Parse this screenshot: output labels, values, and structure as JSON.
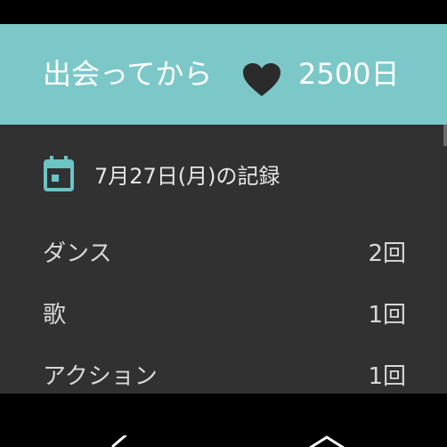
{
  "header": {
    "title": "出会ってから",
    "days": "2500日",
    "icon": "heart-icon",
    "background_color": "#7cc8c8"
  },
  "record": {
    "icon": "calendar-icon",
    "date_label": "7月27日(月)の記録",
    "accent_color": "#6cc4c4",
    "items": [
      {
        "label": "ダンス",
        "count": "2回"
      },
      {
        "label": "歌",
        "count": "1回"
      },
      {
        "label": "アクション",
        "count": "1回"
      }
    ]
  },
  "nav": {
    "back_icon": "back-icon",
    "home_icon": "home-icon"
  }
}
